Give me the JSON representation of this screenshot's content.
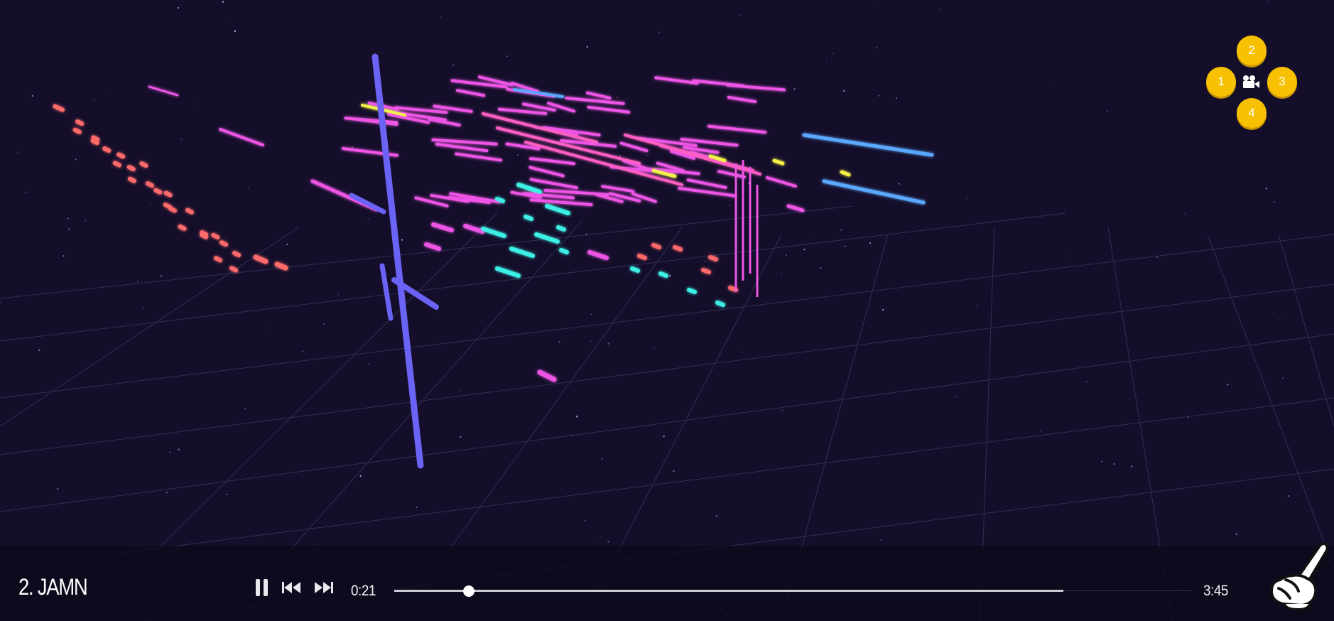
{
  "track": {
    "title": "2. JAMN"
  },
  "player": {
    "current_time": "0:21",
    "total_time": "3:45",
    "progress_fraction": 0.093,
    "buffered_fraction": 0.838
  },
  "camera_views": [
    "1",
    "2",
    "3",
    "4"
  ],
  "icons": {
    "pause": "pause-icon",
    "previous": "skip-back-icon",
    "next": "skip-forward-icon",
    "camera": "video-camera-icon",
    "cursor": "pointing-hand-icon"
  },
  "colors": {
    "background": "#140e2a",
    "grid": "#3a3a66",
    "camera_button": "#f7c000",
    "bar_blue": "#6a63f5",
    "note_magenta": "#ee55e6",
    "note_pink": "#ff5fc4",
    "note_cyan": "#3ef0e6",
    "note_salmon": "#ff6a6a",
    "note_yellow": "#f2f04a",
    "note_sky": "#5aa8ff"
  }
}
